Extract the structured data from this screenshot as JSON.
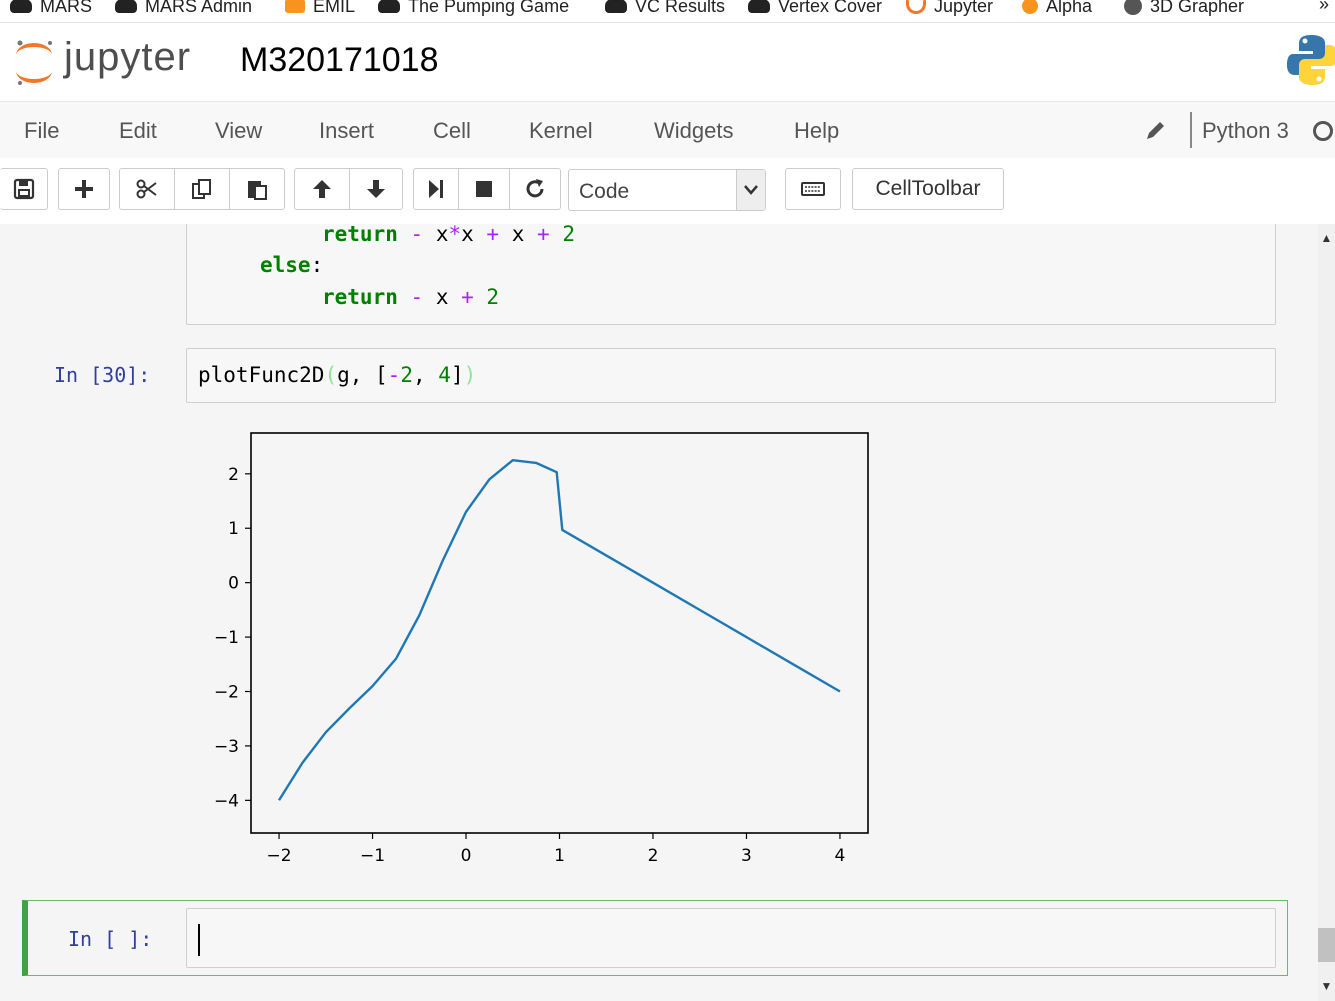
{
  "bookmarks": [
    {
      "label": "MARS",
      "icon": "mars-icon"
    },
    {
      "label": "MARS Admin",
      "icon": "mars-admin-icon"
    },
    {
      "label": "EMIL",
      "icon": "moodle-icon"
    },
    {
      "label": "The Pumping Game",
      "icon": "game-icon"
    },
    {
      "label": "VC Results",
      "icon": "vc-icon"
    },
    {
      "label": "Vertex Cover",
      "icon": "vertex-icon"
    },
    {
      "label": "Jupyter",
      "icon": "jupyter-icon"
    },
    {
      "label": "Alpha",
      "icon": "alpha-icon"
    },
    {
      "label": "3D Grapher",
      "icon": "globe-icon"
    }
  ],
  "bookmarks_more": "»",
  "header": {
    "logo_text": "jupyter",
    "notebook_title": "M320171018"
  },
  "menu": [
    "File",
    "Edit",
    "View",
    "Insert",
    "Cell",
    "Kernel",
    "Widgets",
    "Help"
  ],
  "kernel": {
    "name": "Python 3"
  },
  "toolbar": {
    "cell_type": "Code",
    "celltoolbar_label": "CellToolbar",
    "icons": [
      "save-icon",
      "plus-icon",
      "cut-icon",
      "copy-icon",
      "paste-icon",
      "arrow-up-icon",
      "arrow-down-icon",
      "run-icon",
      "stop-icon",
      "restart-icon",
      "keyboard-icon"
    ]
  },
  "cells": {
    "partial_code": {
      "line1": {
        "kw": "return",
        "rest": [
          [
            "op",
            "-"
          ],
          [
            "txt",
            " x"
          ],
          [
            "op",
            "*"
          ],
          [
            "txt",
            "x "
          ],
          [
            "op",
            "+"
          ],
          [
            "txt",
            " x "
          ],
          [
            "op",
            "+"
          ],
          [
            "txt",
            " "
          ],
          [
            "num",
            "2"
          ]
        ]
      },
      "line2": {
        "kw": "else",
        "colon": ":"
      },
      "line3": {
        "kw": "return",
        "rest": [
          [
            "op",
            "-"
          ],
          [
            "txt",
            " x "
          ],
          [
            "op",
            "+"
          ],
          [
            "txt",
            " "
          ],
          [
            "num",
            "2"
          ]
        ]
      }
    },
    "cell30": {
      "prompt": "In [30]:",
      "code_func": "plotFunc2D",
      "code_open": "(",
      "code_arg": "g, [",
      "code_minus": "-",
      "code_two": "2",
      "code_comma": ", ",
      "code_four": "4",
      "code_close_bracket": "]",
      "code_close": ")"
    },
    "empty_cell": {
      "prompt": "In [ ]:"
    }
  },
  "chart_data": {
    "type": "line",
    "xlim": [
      -2.3,
      4.3
    ],
    "ylim": [
      -4.6,
      2.75
    ],
    "xticks": [
      -2,
      -1,
      0,
      1,
      2,
      3,
      4
    ],
    "yticks": [
      -4,
      -3,
      -2,
      -1,
      0,
      1,
      2
    ],
    "xtick_labels": [
      "−2",
      "−1",
      "0",
      "1",
      "2",
      "3",
      "4"
    ],
    "ytick_labels": [
      "−4",
      "−3",
      "−2",
      "−1",
      "0",
      "1",
      "2"
    ],
    "series_color": "#1f77b4",
    "x": [
      -2,
      -1.75,
      -1.5,
      -1.25,
      -1,
      -0.75,
      -0.5,
      -0.25,
      0,
      0.25,
      0.5,
      0.75,
      0.97,
      1.03,
      1.5,
      2,
      2.5,
      3,
      3.5,
      4
    ],
    "y": [
      -4,
      -3.3125,
      -2.75,
      -2.3125,
      -1.9,
      -1.4,
      -0.6,
      0.4,
      1.3,
      1.9,
      2.25,
      2.2,
      2.03,
      0.97,
      0.5,
      0,
      -0.5,
      -1,
      -1.5,
      -2
    ],
    "grid": false
  }
}
